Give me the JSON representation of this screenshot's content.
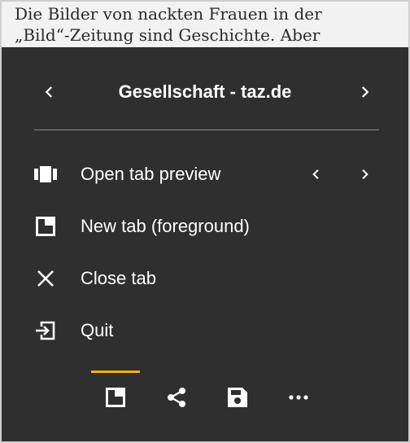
{
  "background_article": {
    "line1": "Die Bilder von nackten Frauen in der",
    "line2": "„Bild“-Zeitung sind Geschichte. Aber"
  },
  "header": {
    "title": "Gesellschaft - taz.de",
    "prev_icon": "chevron-left-icon",
    "next_icon": "chevron-right-icon"
  },
  "menu": {
    "items": [
      {
        "label": "Open tab preview",
        "icon": "tab-preview-icon"
      },
      {
        "label": "New tab (foreground)",
        "icon": "new-tab-icon"
      },
      {
        "label": "Close tab",
        "icon": "close-icon"
      },
      {
        "label": "Quit",
        "icon": "exit-icon"
      }
    ]
  },
  "bottom_bar": {
    "buttons": [
      "tab-icon",
      "share-icon",
      "save-icon",
      "more-icon"
    ],
    "active_index": 0
  },
  "colors": {
    "sheet_bg": "#2f2f2f",
    "accent": "#f5b01a",
    "text": "#ffffff"
  }
}
